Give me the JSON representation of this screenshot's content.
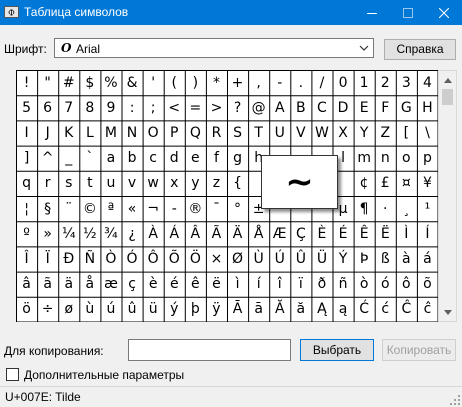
{
  "window": {
    "title": "Таблица символов",
    "title_bar_color": "#0078d7",
    "icons": [
      "app-icon",
      "minimize-icon",
      "maximize-icon",
      "close-icon"
    ]
  },
  "font": {
    "label": "Шрифт:",
    "selected": "Arial",
    "type_glyph": "O"
  },
  "buttons": {
    "help": "Справка",
    "choose": "Выбрать",
    "copy": "Копировать"
  },
  "grid": {
    "columns": 20,
    "rows": [
      [
        "!",
        "\"",
        "#",
        "$",
        "%",
        "&",
        "'",
        "(",
        ")",
        "*",
        "+",
        ",",
        "-",
        ".",
        "/",
        "0",
        "1",
        "2",
        "3",
        "4"
      ],
      [
        "5",
        "6",
        "7",
        "8",
        "9",
        ":",
        ";",
        "<",
        "=",
        ">",
        "?",
        "@",
        "A",
        "B",
        "C",
        "D",
        "E",
        "F",
        "G",
        "H"
      ],
      [
        "I",
        "J",
        "K",
        "L",
        "M",
        "N",
        "O",
        "P",
        "Q",
        "R",
        "S",
        "T",
        "U",
        "V",
        "W",
        "X",
        "Y",
        "Z",
        "[",
        "\\"
      ],
      [
        "]",
        "^",
        "_",
        "`",
        "a",
        "b",
        "c",
        "d",
        "e",
        "f",
        "g",
        "h",
        "",
        "",
        "",
        "l",
        "m",
        "n",
        "o",
        "p"
      ],
      [
        "q",
        "r",
        "s",
        "t",
        "u",
        "v",
        "w",
        "x",
        "y",
        "z",
        "{",
        "",
        "",
        "",
        "",
        "",
        "¢",
        "£",
        "¤",
        "¥"
      ],
      [
        "¦",
        "§",
        "¨",
        "©",
        "ª",
        "«",
        "¬",
        "-",
        "®",
        "¯",
        "°",
        "±",
        "",
        "",
        "",
        "µ",
        "¶",
        "·",
        "¸",
        "¹"
      ],
      [
        "º",
        "»",
        "¼",
        "½",
        "¾",
        "¿",
        "À",
        "Á",
        "Â",
        "Ã",
        "Ä",
        "Å",
        "Æ",
        "Ç",
        "È",
        "É",
        "Ê",
        "Ë",
        "Ì",
        "Í"
      ],
      [
        "Î",
        "Ï",
        "Ð",
        "Ñ",
        "Ò",
        "Ó",
        "Ô",
        "Õ",
        "Ö",
        "×",
        "Ø",
        "Ù",
        "Ú",
        "Û",
        "Ü",
        "Ý",
        "Þ",
        "ß",
        "à",
        "á"
      ],
      [
        "â",
        "ã",
        "ä",
        "å",
        "æ",
        "ç",
        "è",
        "é",
        "ê",
        "ë",
        "ì",
        "í",
        "î",
        "ï",
        "ð",
        "ñ",
        "ò",
        "ó",
        "ô",
        "õ"
      ],
      [
        "ö",
        "÷",
        "ø",
        "ù",
        "ú",
        "û",
        "ü",
        "ý",
        "þ",
        "ÿ",
        "Ā",
        "ā",
        "Ă",
        "ă",
        "Ą",
        "ą",
        "Ć",
        "ć",
        "Ĉ",
        "ĉ"
      ]
    ],
    "magnified": "~"
  },
  "copy": {
    "label": "Для копирования:",
    "value": ""
  },
  "advanced": {
    "label": "Дополнительные параметры",
    "checked": false
  },
  "status": {
    "text": "U+007E: Tilde"
  }
}
